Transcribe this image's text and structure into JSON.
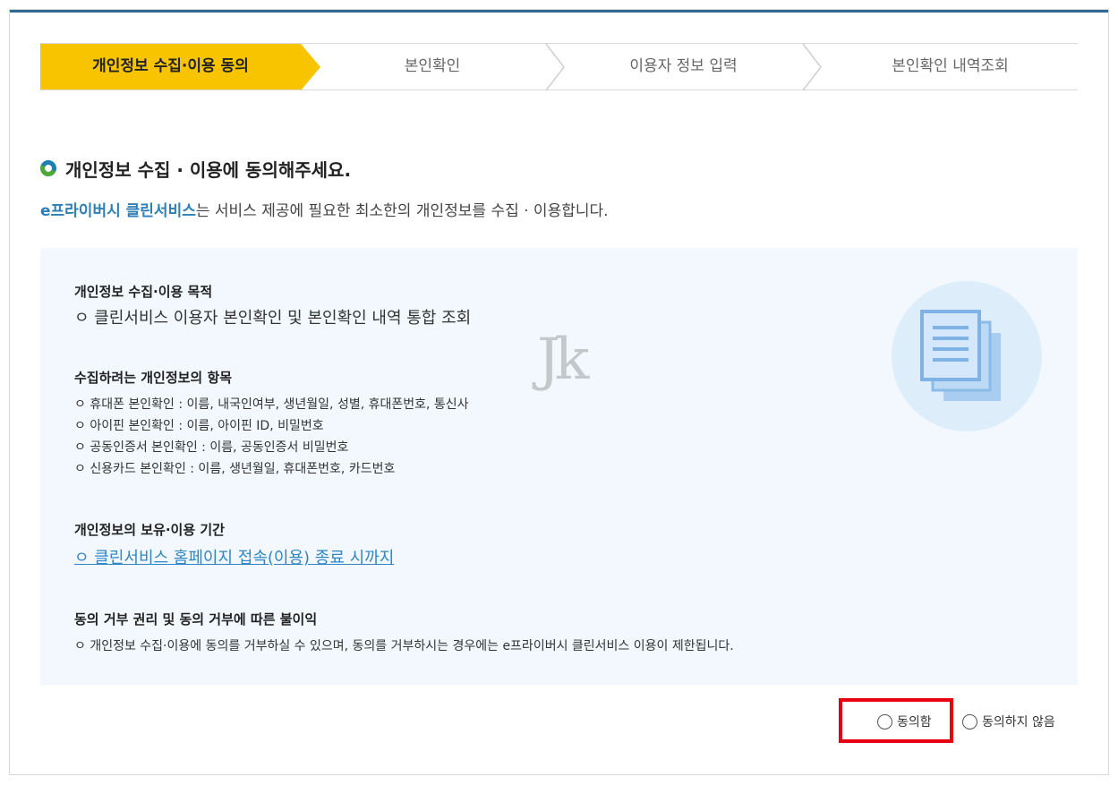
{
  "steps": [
    {
      "label": "개인정보 수집·이용 동의"
    },
    {
      "label": "본인확인"
    },
    {
      "label": "이용자 정보 입력"
    },
    {
      "label": "본인확인 내역조회"
    }
  ],
  "heading": "개인정보 수집 · 이용에 동의해주세요.",
  "subtitle": {
    "brand": "e프라이버시 클린서비스",
    "rest": "는 서비스 제공에 필요한 최소한의 개인정보를 수집 · 이용합니다."
  },
  "watermark": "Jk",
  "sections": {
    "purpose": {
      "title": "개인정보 수집·이용 목적",
      "lines": [
        "ㅇ 클린서비스 이용자 본인확인 및 본인확인 내역 통합 조회"
      ]
    },
    "items": {
      "title": "수집하려는 개인정보의 항목",
      "lines": [
        "ㅇ 휴대폰 본인확인 : 이름, 내국인여부, 생년월일, 성별, 휴대폰번호, 통신사",
        "ㅇ 아이핀 본인확인 : 이름, 아이핀 ID, 비밀번호",
        "ㅇ 공동인증서 본인확인 : 이름, 공동인증서 비밀번호",
        "ㅇ 신용카드 본인확인 : 이름, 생년월일, 휴대폰번호, 카드번호"
      ]
    },
    "retention": {
      "title": "개인정보의 보유·이용 기간",
      "link": "ㅇ 클린서비스 홈페이지 접속(이용) 종료 시까지"
    },
    "refusal": {
      "title": "동의 거부 권리 및 동의 거부에 따른 불이익",
      "lines": [
        "ㅇ 개인정보 수집·이용에 동의를 거부하실 수 있으며, 동의를 거부하시는 경우에는 e프라이버시 클린서비스 이용이 제한됩니다."
      ]
    }
  },
  "consent": {
    "agree_label": "동의함",
    "disagree_label": "동의하지 않음"
  },
  "colors": {
    "step_active": "#f8c400",
    "brand_blue": "#2f7fb7",
    "highlight_red": "#e60012",
    "infobox_bg": "#f2f8fd"
  }
}
